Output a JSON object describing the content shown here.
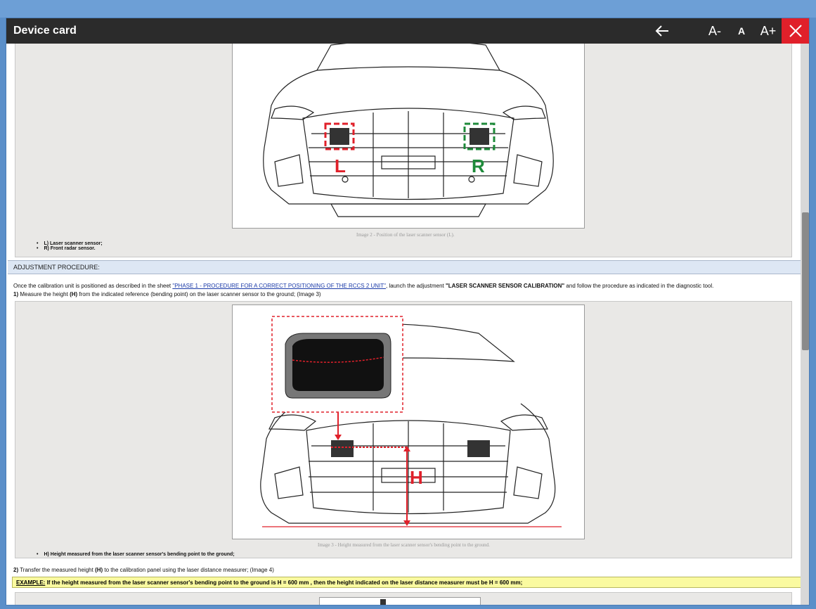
{
  "window": {
    "title": "Device card"
  },
  "toolbar": {
    "back_icon": "arrow-left-icon",
    "font_decrease_label": "A-",
    "font_reset_label": "A",
    "font_increase_label": "A+",
    "close_icon": "close-icon",
    "close_color": "#e0202a"
  },
  "figure2": {
    "label_left": "L",
    "label_right": "R",
    "caption": "Image 2 - Position of the laser scanner sensor (L).",
    "bullets": [
      "L) Laser scanner sensor;",
      "R) Front radar sensor."
    ]
  },
  "adjustment": {
    "heading": "ADJUSTMENT PROCEDURE:",
    "intro_prefix": "Once the calibration unit is positioned as described in the sheet ",
    "intro_link": "\"PHASE 1 - PROCEDURE FOR A CORRECT POSITIONING OF THE RCCS 2 UNIT\"",
    "intro_mid": ", launch the adjustment ",
    "intro_bold": "\"LASER SCANNER SENSOR CALIBRATION\"",
    "intro_suffix": " and follow the procedure as indicated in the diagnostic tool.",
    "step1_num": "1)",
    "step1_text_a": " Measure the height ",
    "step1_h": "(H)",
    "step1_text_b": " from the indicated reference (bending point) on the laser scanner sensor to the ground; (Image 3)"
  },
  "figure3": {
    "label_h": "H",
    "caption": "Image 3 - Height measured from the laser scanner sensor's bending point to the ground.",
    "bullets": [
      "H) Height measured from the laser scanner sensor's bending point to the ground;"
    ]
  },
  "step2": {
    "num": "2)",
    "text_a": " Transfer the measured height ",
    "h": "(H)",
    "text_b": " to the calibration panel using the laser distance measurer; (Image 4)"
  },
  "example": {
    "label": "EXAMPLE:",
    "text": " If the height measured from the laser scanner sensor's bending point to the ground is H = 600 mm , then the height indicated on the laser distance measurer must be H = 600 mm;"
  }
}
